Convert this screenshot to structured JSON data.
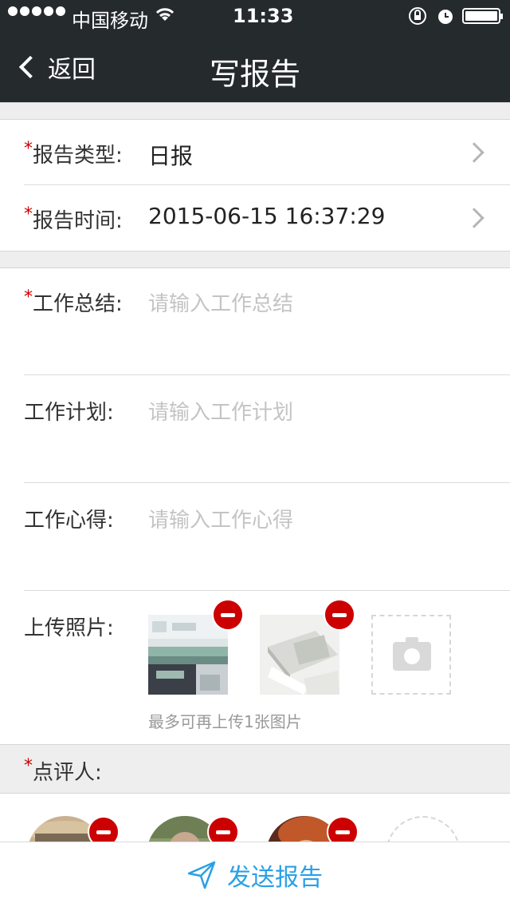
{
  "status_bar": {
    "carrier": "中国移动",
    "time": "11:33"
  },
  "nav": {
    "back_label": "返回",
    "title": "写报告"
  },
  "form": {
    "report_type": {
      "label": "报告类型:",
      "value": "日报"
    },
    "report_time": {
      "label": "报告时间:",
      "value": "2015-06-15 16:37:29"
    },
    "summary": {
      "label": "工作总结:",
      "placeholder": "请输入工作总结"
    },
    "plan": {
      "label": "工作计划:",
      "placeholder": "请输入工作计划"
    },
    "insight": {
      "label": "工作心得:",
      "placeholder": "请输入工作心得"
    },
    "photos": {
      "label": "上传照片:",
      "hint": "最多可再上传1张图片"
    }
  },
  "reviewers": {
    "label": "点评人:"
  },
  "bottom": {
    "send_label": "发送报告"
  },
  "colors": {
    "accent": "#2aa0e6",
    "required": "#cc0000",
    "bar": "#252a2d",
    "delete": "#cc0000"
  }
}
